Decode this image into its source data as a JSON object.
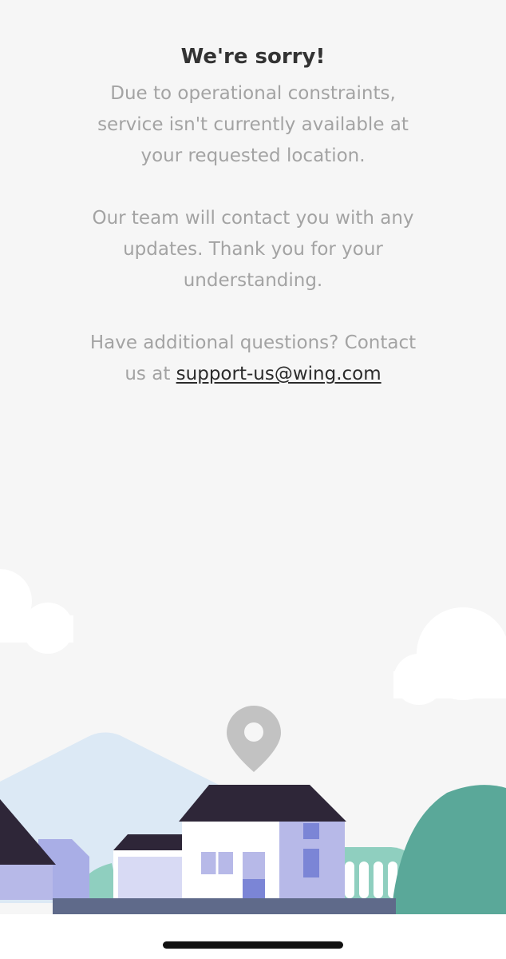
{
  "message": {
    "title": "We're sorry!",
    "line1": "Due to operational constraints,",
    "line2": "service isn't currently available at",
    "line3": "your requested location.",
    "line4": "Our team will contact you with any",
    "line5": "updates. Thank you for your",
    "line6": "understanding.",
    "line7": "Have additional questions? Contact",
    "line8_prefix": "us at ",
    "email": "support-us@wing.com"
  },
  "colors": {
    "background": "#f6f6f6",
    "title": "#333333",
    "body_text": "#a3a3a3",
    "sky_mountain": "#dce9f5",
    "house_roof": "#2e2638",
    "house_wall": "#ffffff",
    "house_side": "#b7b9e8",
    "window_accent": "#7b85d6",
    "tree_green": "#5aa899",
    "road": "#5f6a8a",
    "pin": "#c0c0c0"
  },
  "illustration": {
    "icon": "location-pin-icon",
    "scene": "houses-hills-clouds"
  }
}
